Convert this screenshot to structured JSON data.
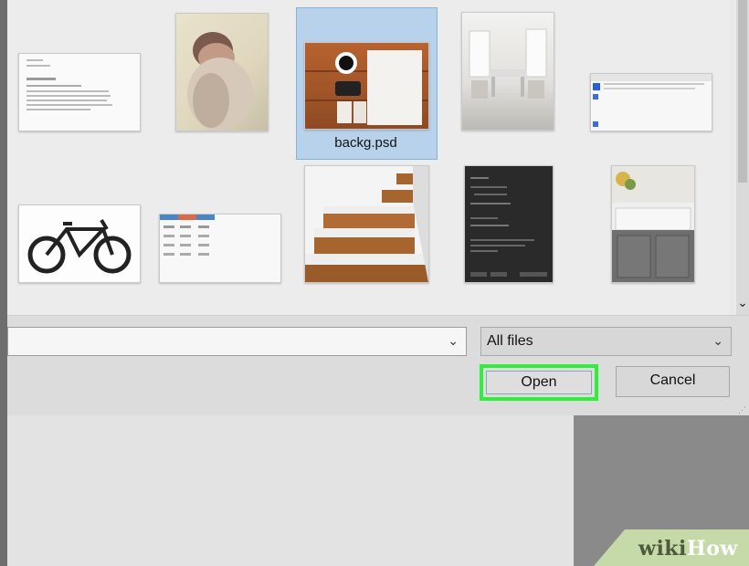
{
  "file_browser": {
    "selected_file": "backg.psd",
    "files": [
      {
        "icon": "document-thumbnail"
      },
      {
        "icon": "baby-photo-thumbnail"
      },
      {
        "icon": "desk-photo-thumbnail",
        "label": "backg.psd",
        "selected": true
      },
      {
        "icon": "white-room-thumbnail"
      },
      {
        "icon": "web-page-thumbnail"
      },
      {
        "icon": "bicycle-thumbnail"
      },
      {
        "icon": "spreadsheet-thumbnail"
      },
      {
        "icon": "wood-stairs-thumbnail"
      },
      {
        "icon": "dark-settings-thumbnail"
      },
      {
        "icon": "kitchen-sink-thumbnail"
      }
    ]
  },
  "footer": {
    "filename_value": "",
    "file_type_filter": "All files",
    "open_label": "Open",
    "cancel_label": "Cancel"
  },
  "watermark": {
    "part1": "wiki",
    "part2": "How"
  },
  "colors": {
    "highlight_border": "#2ef03a",
    "selection_fill": "#b7d2ea"
  }
}
